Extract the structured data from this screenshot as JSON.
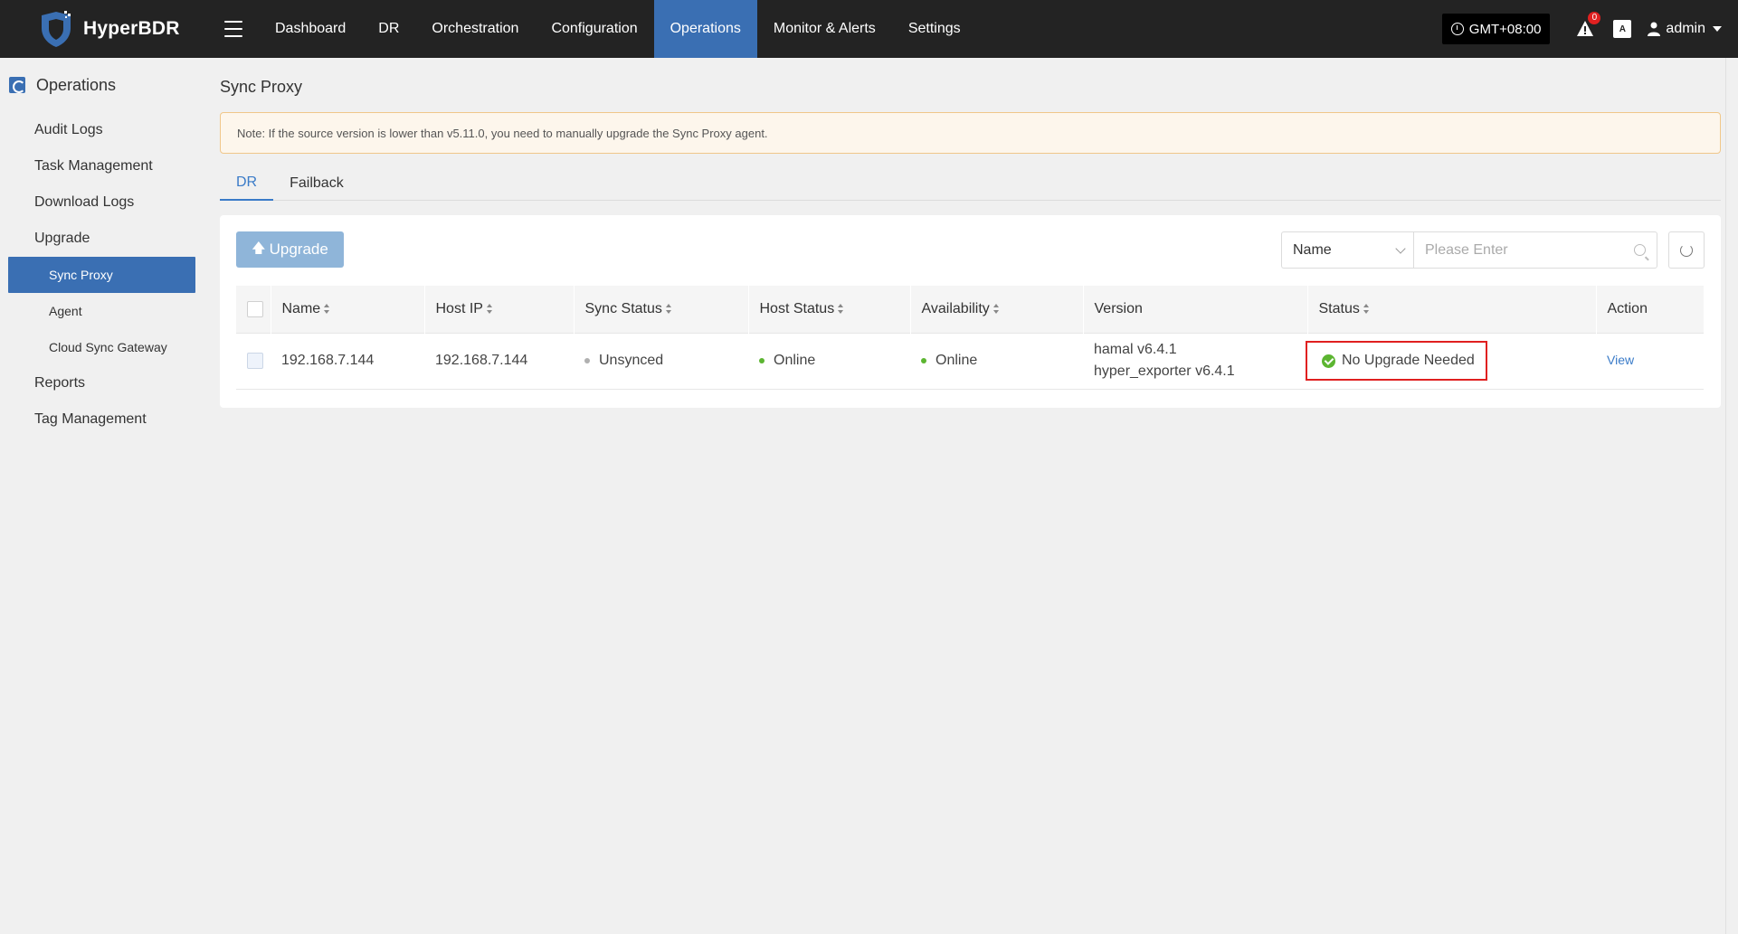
{
  "app": {
    "name": "HyperBDR"
  },
  "nav": {
    "items": [
      {
        "label": "Dashboard",
        "active": false
      },
      {
        "label": "DR",
        "active": false
      },
      {
        "label": "Orchestration",
        "active": false
      },
      {
        "label": "Configuration",
        "active": false
      },
      {
        "label": "Operations",
        "active": true
      },
      {
        "label": "Monitor & Alerts",
        "active": false
      },
      {
        "label": "Settings",
        "active": false
      }
    ],
    "timezone": "GMT+08:00",
    "alert_count": "0",
    "lang_icon": "A",
    "user": "admin"
  },
  "sidebar": {
    "header": "Operations",
    "items": [
      {
        "label": "Audit Logs"
      },
      {
        "label": "Task Management"
      },
      {
        "label": "Download Logs"
      },
      {
        "label": "Upgrade"
      }
    ],
    "sub_items": [
      {
        "label": "Sync Proxy",
        "active": true
      },
      {
        "label": "Agent",
        "active": false
      },
      {
        "label": "Cloud Sync Gateway",
        "active": false
      }
    ],
    "bottom_items": [
      {
        "label": "Reports"
      },
      {
        "label": "Tag Management"
      }
    ]
  },
  "page": {
    "title": "Sync Proxy",
    "note": "Note: If the source version is lower than v5.11.0, you need to manually upgrade the Sync Proxy agent.",
    "tabs": [
      {
        "label": "DR",
        "active": true
      },
      {
        "label": "Failback",
        "active": false
      }
    ],
    "upgrade_button": "Upgrade",
    "filter_select": "Name",
    "search_placeholder": "Please Enter"
  },
  "table": {
    "columns": [
      "Name",
      "Host IP",
      "Sync Status",
      "Host Status",
      "Availability",
      "Version",
      "Status",
      "Action"
    ],
    "rows": [
      {
        "name": "192.168.7.144",
        "host_ip": "192.168.7.144",
        "sync_status": "Unsynced",
        "host_status": "Online",
        "availability": "Online",
        "version_1": "hamal v6.4.1",
        "version_2": "hyper_exporter v6.4.1",
        "status": "No Upgrade Needed",
        "action": "View"
      }
    ]
  },
  "colors": {
    "topbar": "#232323",
    "accent": "#3a6fb3",
    "success": "#5cb531",
    "highlight_border": "#e02020"
  }
}
